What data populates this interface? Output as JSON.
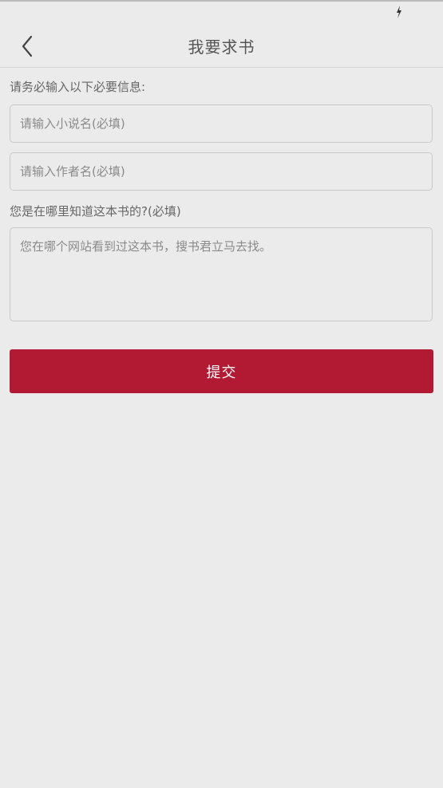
{
  "status_bar": {
    "icon": "lightning-icon"
  },
  "nav": {
    "back_icon": "chevron-left-icon",
    "title": "我要求书"
  },
  "form": {
    "intro_label": "请务必输入以下必要信息:",
    "novel_name": {
      "value": "",
      "placeholder": "请输入小说名(必填)"
    },
    "author_name": {
      "value": "",
      "placeholder": "请输入作者名(必填)"
    },
    "source_label": "您是在哪里知道这本书的?(必填)",
    "source": {
      "value": "",
      "placeholder": "您在哪个网站看到过这本书，搜书君立马去找。"
    },
    "submit_label": "提交"
  },
  "colors": {
    "background": "#ebebeb",
    "accent": "#b21932",
    "border": "#c9c9c9"
  }
}
